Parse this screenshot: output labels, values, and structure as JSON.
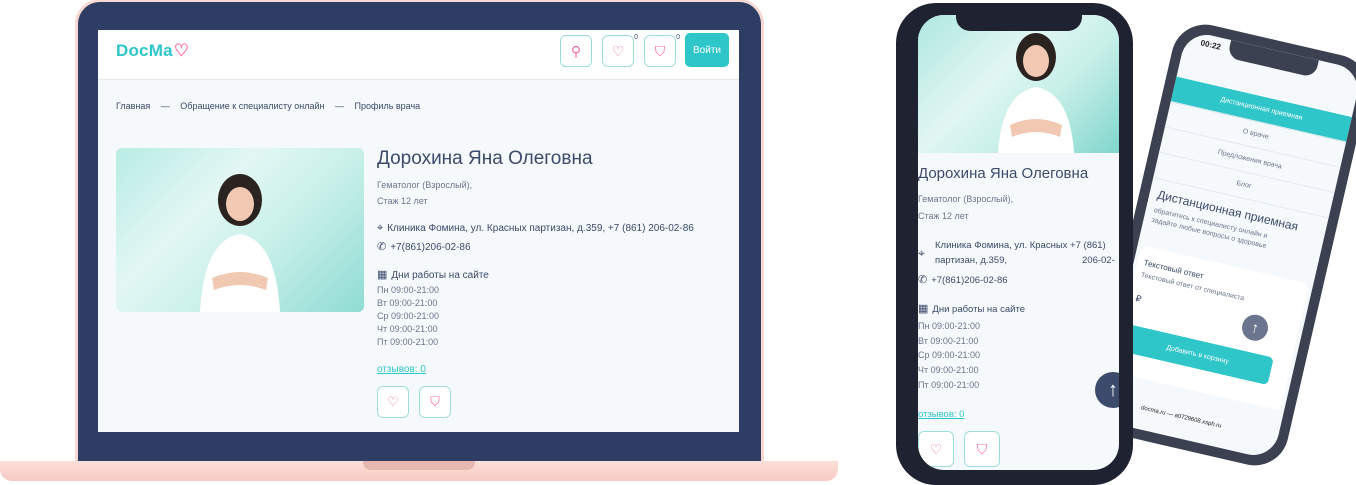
{
  "site": {
    "logo": "DocMa",
    "logo_icon": "heart-logo-icon",
    "header": {
      "search_icon": "search-icon",
      "favorites_icon": "heart-icon",
      "favorites_count": "0",
      "cart_icon": "bag-icon",
      "cart_count": "0",
      "login_label": "Войти"
    },
    "breadcrumb": [
      "Главная",
      "—",
      "Обращение к специалисту онлайн",
      "—",
      "Профиль врача"
    ],
    "doctor": {
      "name": "Дорохина Яна Олеговна",
      "specialty": "Гематолог (Взрослый),",
      "experience": "Стаж 12 лет",
      "clinic": "Клиника Фомина, ул. Красных партизан, д.359, +7 (861) 206-02-86",
      "clinic_line1": "Клиника Фомина, ул. Красных +7 (861)",
      "clinic_line2": "партизан, д.359,",
      "clinic_line2_right": "206-02-",
      "phone": "+7(861)206-02-86",
      "schedule_title": "Дни работы на сайте",
      "schedule": [
        "Пн 09:00-21:00",
        "Вт 09:00-21:00",
        "Ср 09:00-21:00",
        "Чт 09:00-21:00",
        "Пт 09:00-21:00"
      ],
      "reviews": "отзывов: 0"
    }
  },
  "phone2": {
    "time": "00:22",
    "tabs": [
      "Дистанционная приемная",
      "О враче",
      "Предложения врача",
      "Блог"
    ],
    "section_title": "Дистанционная приемная",
    "section_sub1": "обратитесь к специалисту онлайн и",
    "section_sub2": "задайте любые вопросы о здоровье",
    "card_title": "Текстовый ответ",
    "card_sub": "Текстовый ответ от специалиста",
    "price": "₽",
    "add_label": "Добавить в корзину",
    "url": "docma.ru — a0729608.xsph.ru"
  },
  "colors": {
    "accent": "#2fc6c9",
    "pink": "#ff6b9e",
    "navy": "#2d3d63",
    "text": "#3c4a6b"
  }
}
